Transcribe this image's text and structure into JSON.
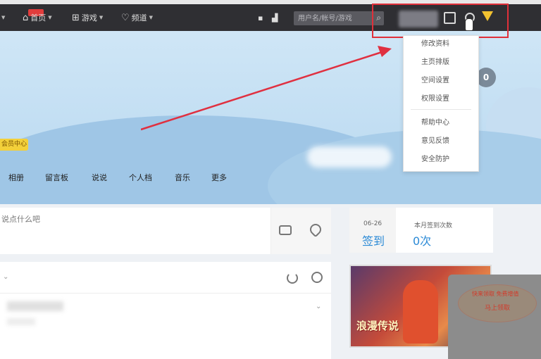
{
  "navbar": {
    "items": [
      {
        "label": "...",
        "badge": ""
      },
      {
        "label": "首页",
        "badge": ""
      },
      {
        "label": "游戏",
        "badge": ""
      },
      {
        "label": "频道",
        "badge": ""
      }
    ],
    "search": {
      "placeholder": "用户名/帐号/游戏"
    },
    "icons": [
      "grid-icon",
      "chart-icon",
      "search-icon",
      "logout-icon",
      "settings-icon",
      "gem-icon"
    ]
  },
  "banner": {
    "vip_label": "会员中心",
    "count": "0",
    "tabs": [
      "相册",
      "留言板",
      "说说",
      "个人档",
      "音乐",
      "更多"
    ]
  },
  "dropdown": {
    "items": [
      "修改资料",
      "主页排版",
      "空间设置",
      "权限设置",
      "帮助中心",
      "意见反馈",
      "安全防护"
    ]
  },
  "composer": {
    "placeholder": "说点什么吧"
  },
  "signin": {
    "date": "06-26",
    "action": "签到",
    "label": "本月签到次数",
    "count": "0次"
  },
  "ad": {
    "text": "浪漫传说"
  },
  "popup": {
    "line1": "快来领取 免费增值",
    "line2": "马上领取"
  },
  "colors": {
    "navbar": "#2f2f33",
    "accent": "#2b8ad6",
    "highlight": "#e0303a",
    "vip": "#f3d03a"
  }
}
